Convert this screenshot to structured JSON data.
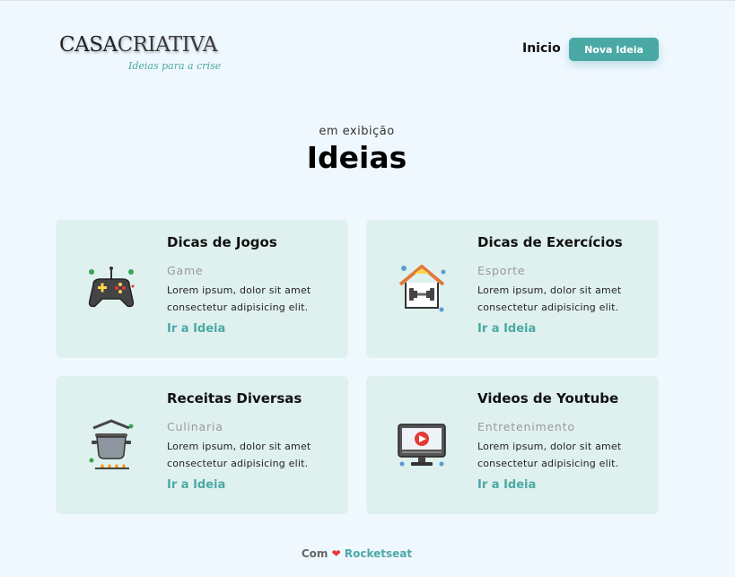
{
  "header": {
    "logo_casa": "CASA",
    "logo_criativa": "CRIATIVA",
    "logo_tagline": "Ideias para a crise",
    "nav_home": "Inicio",
    "new_idea_button": "Nova Ideia"
  },
  "hero": {
    "subtitle": "em exibição",
    "title": "Ideias"
  },
  "cards": [
    {
      "title": "Dicas de Jogos",
      "category": "Game",
      "description": "Lorem ipsum, dolor sit amet consectetur adipisicing elit.",
      "link": "Ir a Ideia",
      "icon": "gamepad-icon"
    },
    {
      "title": "Dicas de Exercícios",
      "category": "Esporte",
      "description": "Lorem ipsum, dolor sit amet consectetur adipisicing elit.",
      "link": "Ir a Ideia",
      "icon": "home-dumbbell-icon"
    },
    {
      "title": "Receitas Diversas",
      "category": "Culinaria",
      "description": "Lorem ipsum, dolor sit amet consectetur adipisicing elit.",
      "link": "Ir a Ideia",
      "icon": "cooking-pot-icon"
    },
    {
      "title": "Videos de Youtube",
      "category": "Entretenimento",
      "description": "Lorem ipsum, dolor sit amet consectetur adipisicing elit.",
      "link": "Ir a Ideia",
      "icon": "video-monitor-icon"
    }
  ],
  "footer": {
    "prefix": "Com",
    "heart": "❤",
    "brand": "Rocketseat"
  },
  "colors": {
    "accent": "#4ba9a5",
    "background": "#f0f8ff",
    "card": "#dff1ee"
  }
}
